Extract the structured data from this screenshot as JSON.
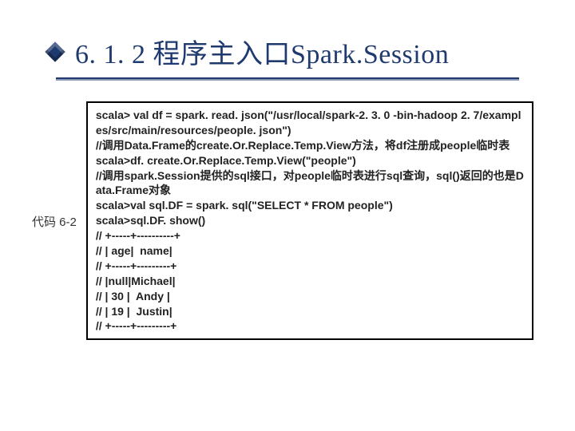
{
  "heading": "6. 1. 2  程序主入口Spark.Session",
  "label": "代码 6-2",
  "code": {
    "l1": "scala> val df = spark. read. json(\"/usr/local/spark-2. 3. 0 -bin-hadoop 2. 7/examples/src/main/resources/people. json\")",
    "l2": "//调用Data.Frame的create.Or.Replace.Temp.View方法，将df注册成people临时表",
    "l3": "scala>df. create.Or.Replace.Temp.View(\"people\")",
    "l4": "//调用spark.Session提供的sql接口，对people临时表进行sql查询，sql()返回的也是Data.Frame对象",
    "l5": "scala>val sql.DF = spark. sql(\"SELECT * FROM people\")",
    "l6": "scala>sql.DF. show()",
    "l7": "// +-----+----------+",
    "l8": "// | age|  name|",
    "l9": "// +-----+---------+",
    "l10": "// |null|Michael|",
    "l11": "// | 30 |  Andy |",
    "l12": "// | 19 |  Justin|",
    "l13": "// +-----+---------+"
  }
}
